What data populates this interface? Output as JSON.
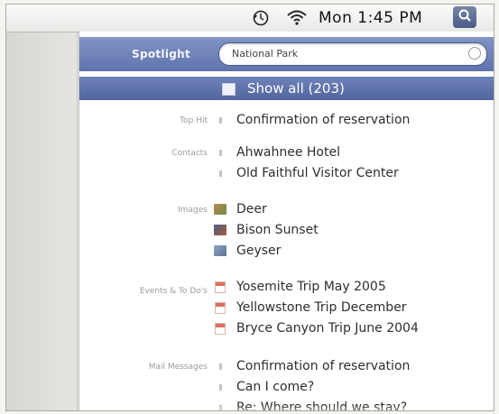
{
  "menubar": {
    "clock": "Mon 1:45 PM",
    "icons": [
      "time-machine-icon",
      "wifi-icon",
      "spotlight-icon"
    ]
  },
  "spotlight": {
    "label": "Spotlight",
    "query": "National Park"
  },
  "show_all": "Show all (203)",
  "categories": [
    {
      "label": "Top Hit",
      "items": [
        {
          "text": "Confirmation of reservation",
          "icon": "document-icon"
        }
      ]
    },
    {
      "label": "Contacts",
      "items": [
        {
          "text": "Ahwahnee Hotel",
          "icon": "contact-icon"
        },
        {
          "text": "Old Faithful Visitor Center",
          "icon": "contact-icon"
        }
      ]
    },
    {
      "label": "Images",
      "items": [
        {
          "text": "Deer",
          "icon": "image-thumbnail-icon"
        },
        {
          "text": "Bison Sunset",
          "icon": "image-thumbnail-icon"
        },
        {
          "text": "Geyser",
          "icon": "image-thumbnail-icon"
        }
      ]
    },
    {
      "label": "Events & To Do's",
      "items": [
        {
          "text": "Yosemite Trip May 2005",
          "icon": "calendar-event-icon"
        },
        {
          "text": "Yellowstone Trip December",
          "icon": "calendar-event-icon"
        },
        {
          "text": "Bryce Canyon Trip June 2004",
          "icon": "calendar-event-icon"
        }
      ]
    },
    {
      "label": "Mail Messages",
      "items": [
        {
          "text": "Confirmation of reservation",
          "icon": "mail-icon"
        },
        {
          "text": "Can I come?",
          "icon": "mail-icon"
        },
        {
          "text": "Re: Where should we stay?",
          "icon": "mail-icon"
        }
      ]
    }
  ],
  "colors": {
    "accent": "#6a7fb8",
    "highlight": "#5a6ea6"
  }
}
